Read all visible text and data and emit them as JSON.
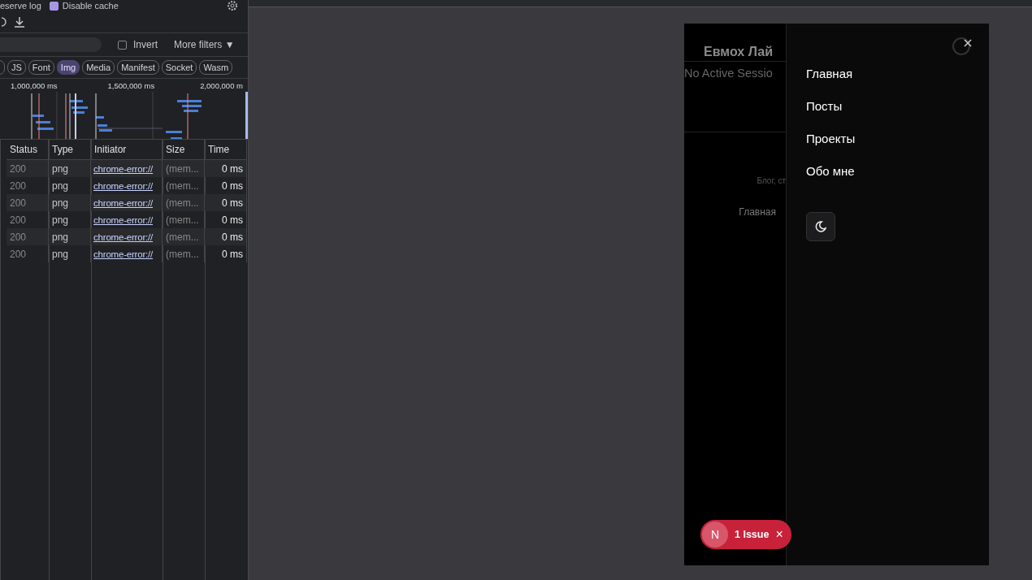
{
  "devtools": {
    "options": [
      {
        "label": "eserve log"
      },
      {
        "label": "Disable cache",
        "checked": true
      }
    ],
    "filter": {
      "invert": {
        "label": "Invert",
        "checked": false
      },
      "more_filters": "More filters ▼"
    },
    "type_chips": [
      {
        "selected": false
      },
      {
        "label": "JS",
        "selected": false
      },
      {
        "label": "Font",
        "selected": false
      },
      {
        "label": "Img",
        "selected": true
      },
      {
        "label": "Media",
        "selected": false
      },
      {
        "label": "Manifest",
        "selected": false
      },
      {
        "label": "Socket",
        "selected": false
      },
      {
        "label": "Wasm",
        "selected": false
      }
    ],
    "overview_ticks": [
      "1,000,000 ms",
      "1,500,000 ms",
      "2,000,000 m"
    ],
    "table": {
      "columns": [
        "Status",
        "Type",
        "Initiator",
        "Size",
        "Time"
      ],
      "rows": [
        [
          "200",
          "png",
          "chrome-error://",
          "(mem...",
          "0 ms"
        ],
        [
          "200",
          "png",
          "chrome-error://",
          "(mem...",
          "0 ms"
        ],
        [
          "200",
          "png",
          "chrome-error://",
          "(mem...",
          "0 ms"
        ],
        [
          "200",
          "png",
          "chrome-error://",
          "(mem...",
          "0 ms"
        ],
        [
          "200",
          "png",
          "chrome-error://",
          "(mem...",
          "0 ms"
        ],
        [
          "200",
          "png",
          "chrome-error://",
          "(mem...",
          "0 ms"
        ]
      ]
    }
  },
  "page": {
    "site_title": "Евмох Лай",
    "session": "No Active Sessio",
    "subtitle": "Блог, ст",
    "footer_link": "Главная",
    "menu": {
      "items": [
        "Главная",
        "Посты",
        "Проекты",
        "Обо мне"
      ]
    },
    "issues_badge": {
      "letter": "N",
      "label": "1 Issue",
      "close": "×"
    }
  }
}
